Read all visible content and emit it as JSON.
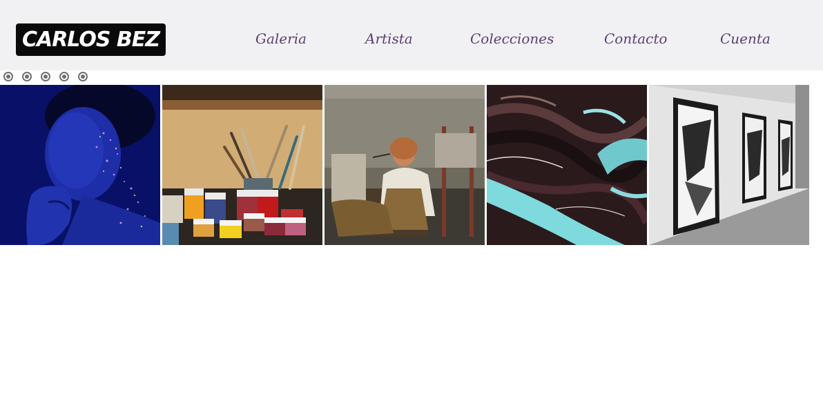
{
  "header": {
    "logo_text": "CARLOS BEZ",
    "nav": [
      {
        "label": "Galeria"
      },
      {
        "label": "Artista"
      },
      {
        "label": "Colecciones"
      },
      {
        "label": "Contacto"
      },
      {
        "label": "Cuenta"
      }
    ]
  },
  "carousel": {
    "dot_count": 5,
    "images": [
      {
        "subject": "portrait-blue-glitter"
      },
      {
        "subject": "paint-jars-brushes"
      },
      {
        "subject": "painter-in-studio"
      },
      {
        "subject": "abstract-fluid-art"
      },
      {
        "subject": "gallery-wall-frames"
      }
    ]
  },
  "colors": {
    "header_bg": "#f1f1f3",
    "nav_text": "#5a3f73",
    "logo_bg": "#0a0a0a",
    "logo_text": "#ffffff"
  }
}
